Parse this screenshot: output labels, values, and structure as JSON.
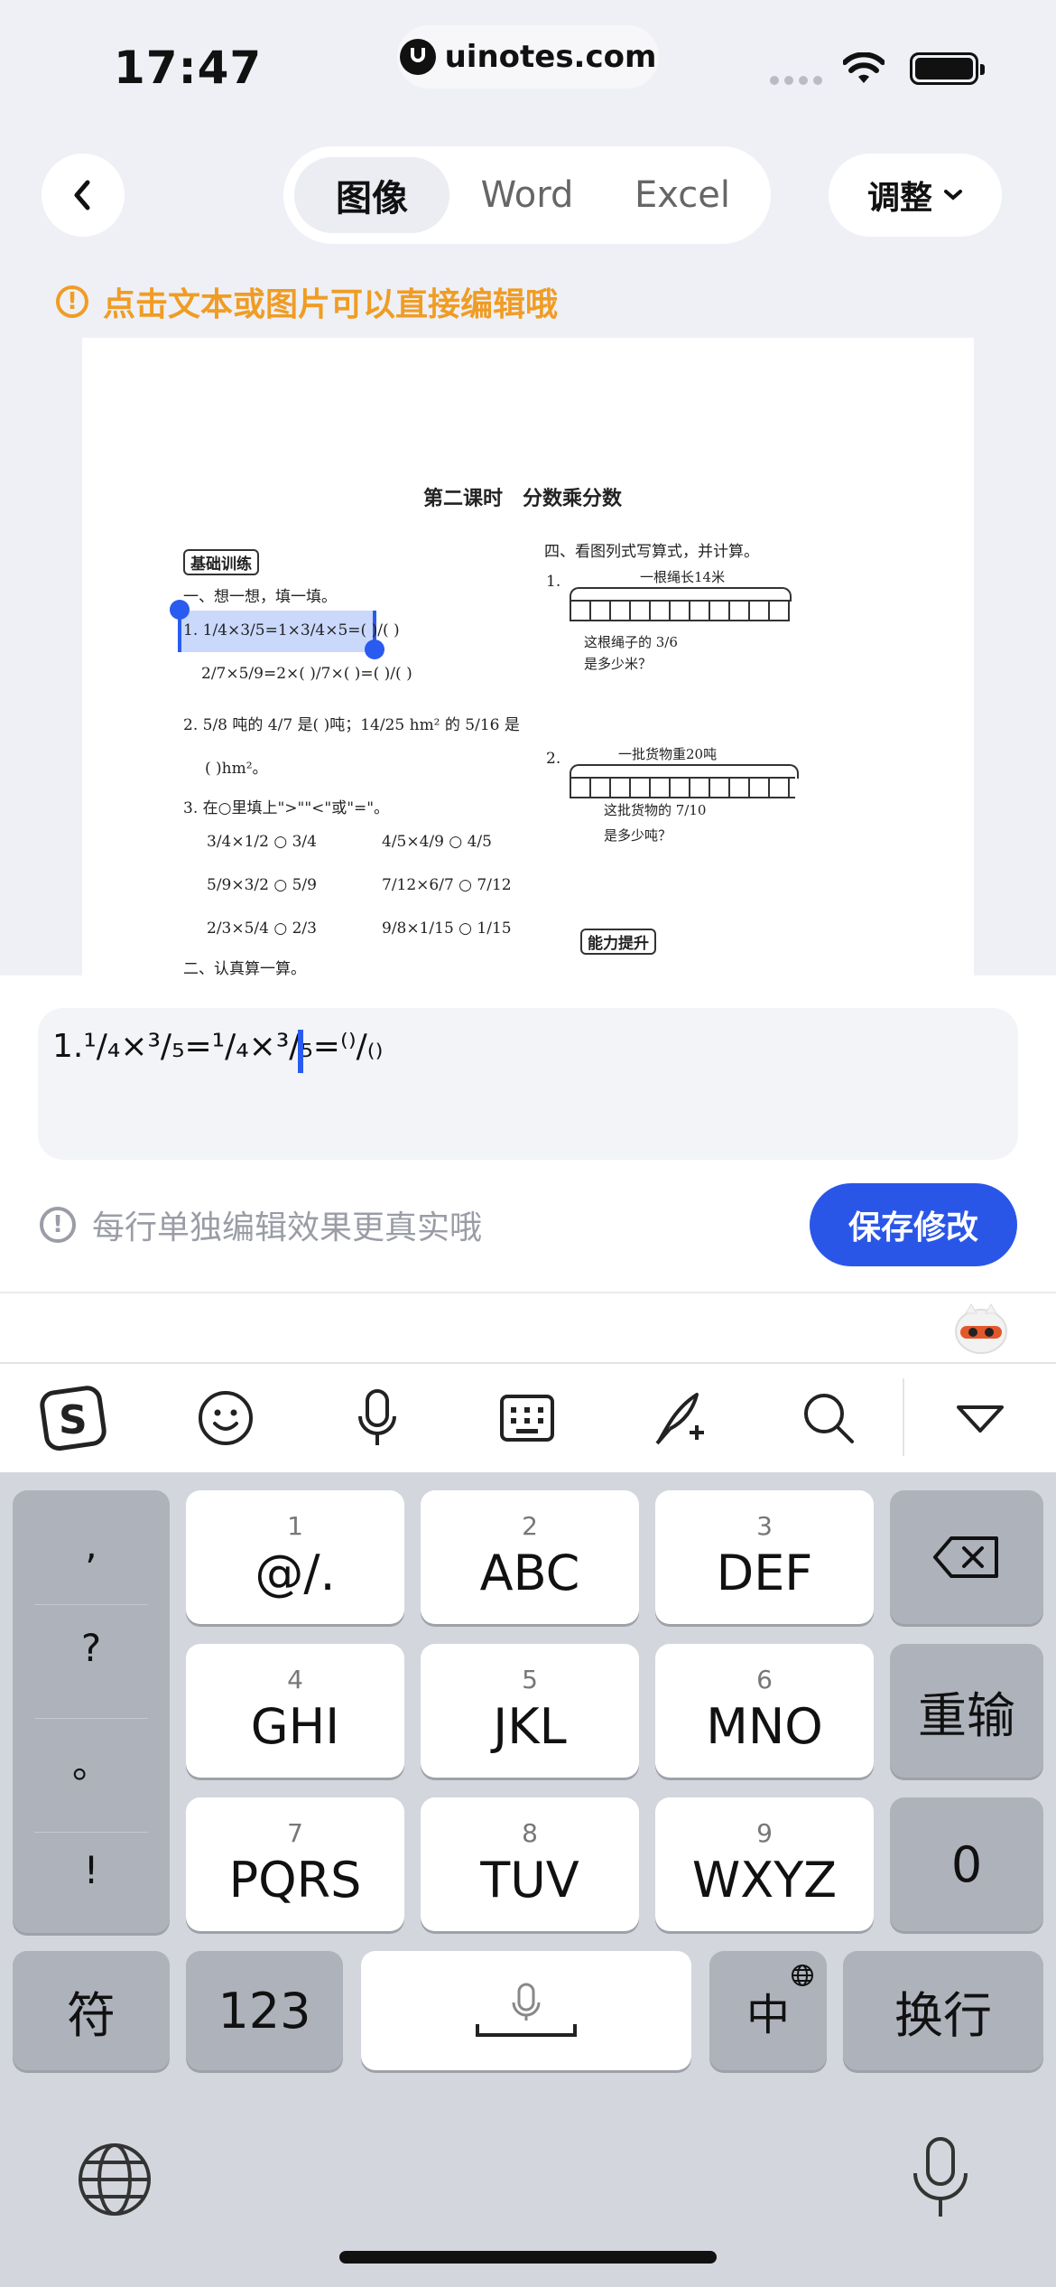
{
  "status_bar": {
    "time": "17:47",
    "url": "uinotes.com"
  },
  "header": {
    "tabs": [
      {
        "label": "图像",
        "active": true
      },
      {
        "label": "Word",
        "active": false
      },
      {
        "label": "Excel",
        "active": false
      }
    ],
    "adjust_label": "调整",
    "hint": "点击文本或图片可以直接编辑哦"
  },
  "document": {
    "title": "第二课时　分数乘分数",
    "basic_training": "基础训练",
    "section1": "一、想一想，填一填。",
    "q1_line1": "1. 1/4×3/5=1×3/4×5=(  )/(  )",
    "q1_line2": "2/7×5/9=2×(  )/7×(  )=(  )/(  )",
    "q2_line1": "2. 5/8 吨的 4/7 是(      )吨；14/25 hm² 的 5/16 是",
    "q2_line2": "(        )hm²。",
    "q3_line1": "3. 在○里填上\">\"\"<\"或\"=\"。",
    "q3_rows": [
      [
        "3/4×1/2 ○ 3/4",
        "4/5×4/9 ○ 4/5"
      ],
      [
        "5/9×3/2 ○ 5/9",
        "7/12×6/7 ○ 7/12"
      ],
      [
        "2/3×5/4 ○ 2/3",
        "9/8×1/15 ○ 1/15"
      ]
    ],
    "section2": "二、认真算一算。",
    "section4": "四、看图列式写算式，并计算。",
    "p1_num": "1.",
    "p1_label": "一根绳长14米",
    "p1_question_1": "这根绳子的 3/6",
    "p1_question_2": "是多少米？",
    "p2_num": "2.",
    "p2_label": "一批货物重20吨",
    "p2_question_1": "这批货物的 7/10",
    "p2_question_2": "是多少吨？",
    "ability": "能力提升"
  },
  "editor": {
    "text": "1.¹/₄×³/₅=¹/₄×³/₅=⁽⁾/₍₎",
    "tip": "每行单独编辑效果更真实哦",
    "save_label": "保存修改"
  },
  "keyboard": {
    "punct": [
      ",",
      "?",
      "。",
      "!"
    ],
    "rows": [
      [
        {
          "num": "1",
          "label": "@/."
        },
        {
          "num": "2",
          "label": "ABC"
        },
        {
          "num": "3",
          "label": "DEF"
        }
      ],
      [
        {
          "num": "4",
          "label": "GHI"
        },
        {
          "num": "5",
          "label": "JKL"
        },
        {
          "num": "6",
          "label": "MNO"
        }
      ],
      [
        {
          "num": "7",
          "label": "PQRS"
        },
        {
          "num": "8",
          "label": "TUV"
        },
        {
          "num": "9",
          "label": "WXYZ"
        }
      ]
    ],
    "retype": "重输",
    "zero": "0",
    "symbols": "符",
    "numbers": "123",
    "lang": "中",
    "enter": "换行"
  },
  "colors": {
    "accent": "#2a56e8",
    "hint": "#f09c24",
    "keyboard_bg": "#d3d6dc"
  }
}
